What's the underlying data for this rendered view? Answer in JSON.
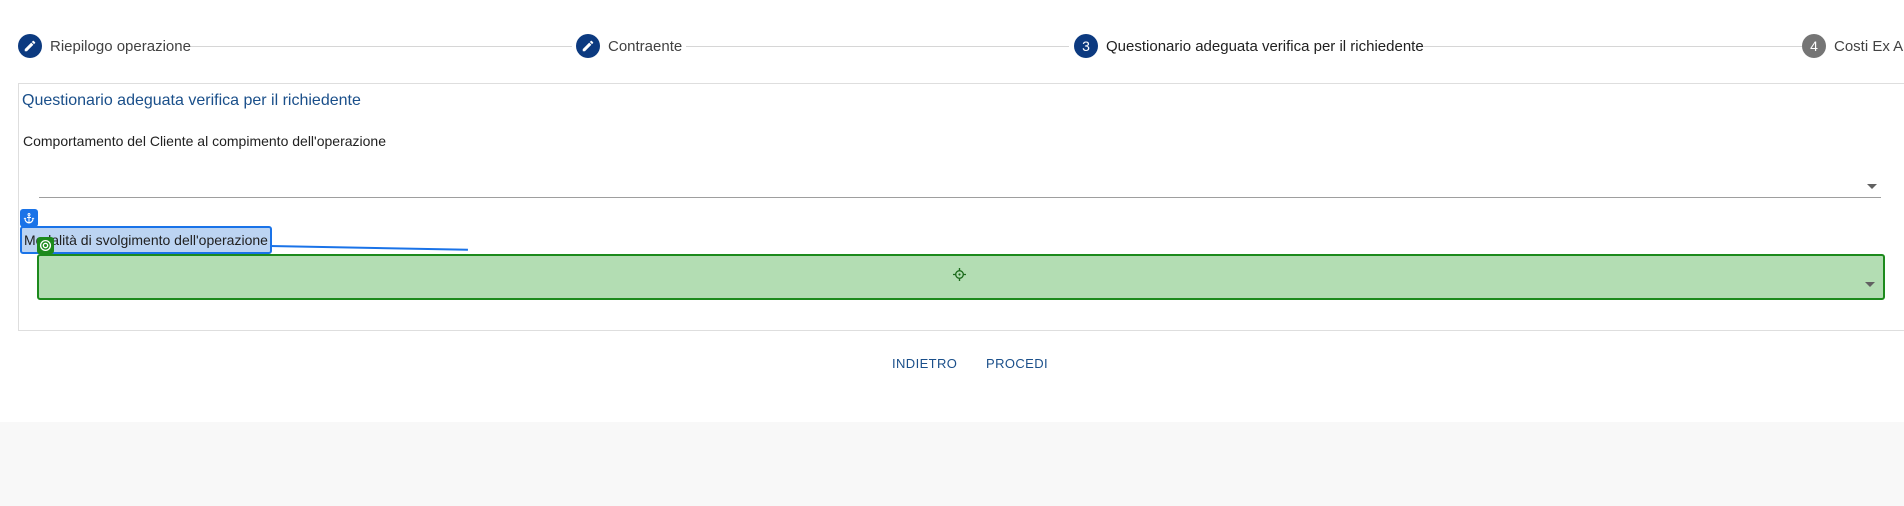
{
  "stepper": {
    "steps": [
      {
        "label": "Riepilogo operazione",
        "marker": "pencil-icon",
        "state": "completed"
      },
      {
        "label": "Contraente",
        "marker": "pencil-icon",
        "state": "completed"
      },
      {
        "label": "Questionario adeguata verifica per il richiedente",
        "marker": "3",
        "state": "active"
      },
      {
        "label": "Costi Ex An",
        "marker": "4",
        "state": "inactive"
      }
    ]
  },
  "form": {
    "title": "Questionario adeguata verifica per il richiedente",
    "fields": [
      {
        "label": "Comportamento del Cliente al compimento dell'operazione",
        "value": ""
      },
      {
        "label": "Modalità di svolgimento dell'operazione",
        "value": ""
      }
    ]
  },
  "actions": {
    "back_label": "INDIETRO",
    "proceed_label": "PROCEDI"
  },
  "colors": {
    "primary": "#0c3a80",
    "link": "#1a4f8a",
    "highlight_label": "#1a73e8",
    "highlight_target": "#1c8a1c"
  }
}
